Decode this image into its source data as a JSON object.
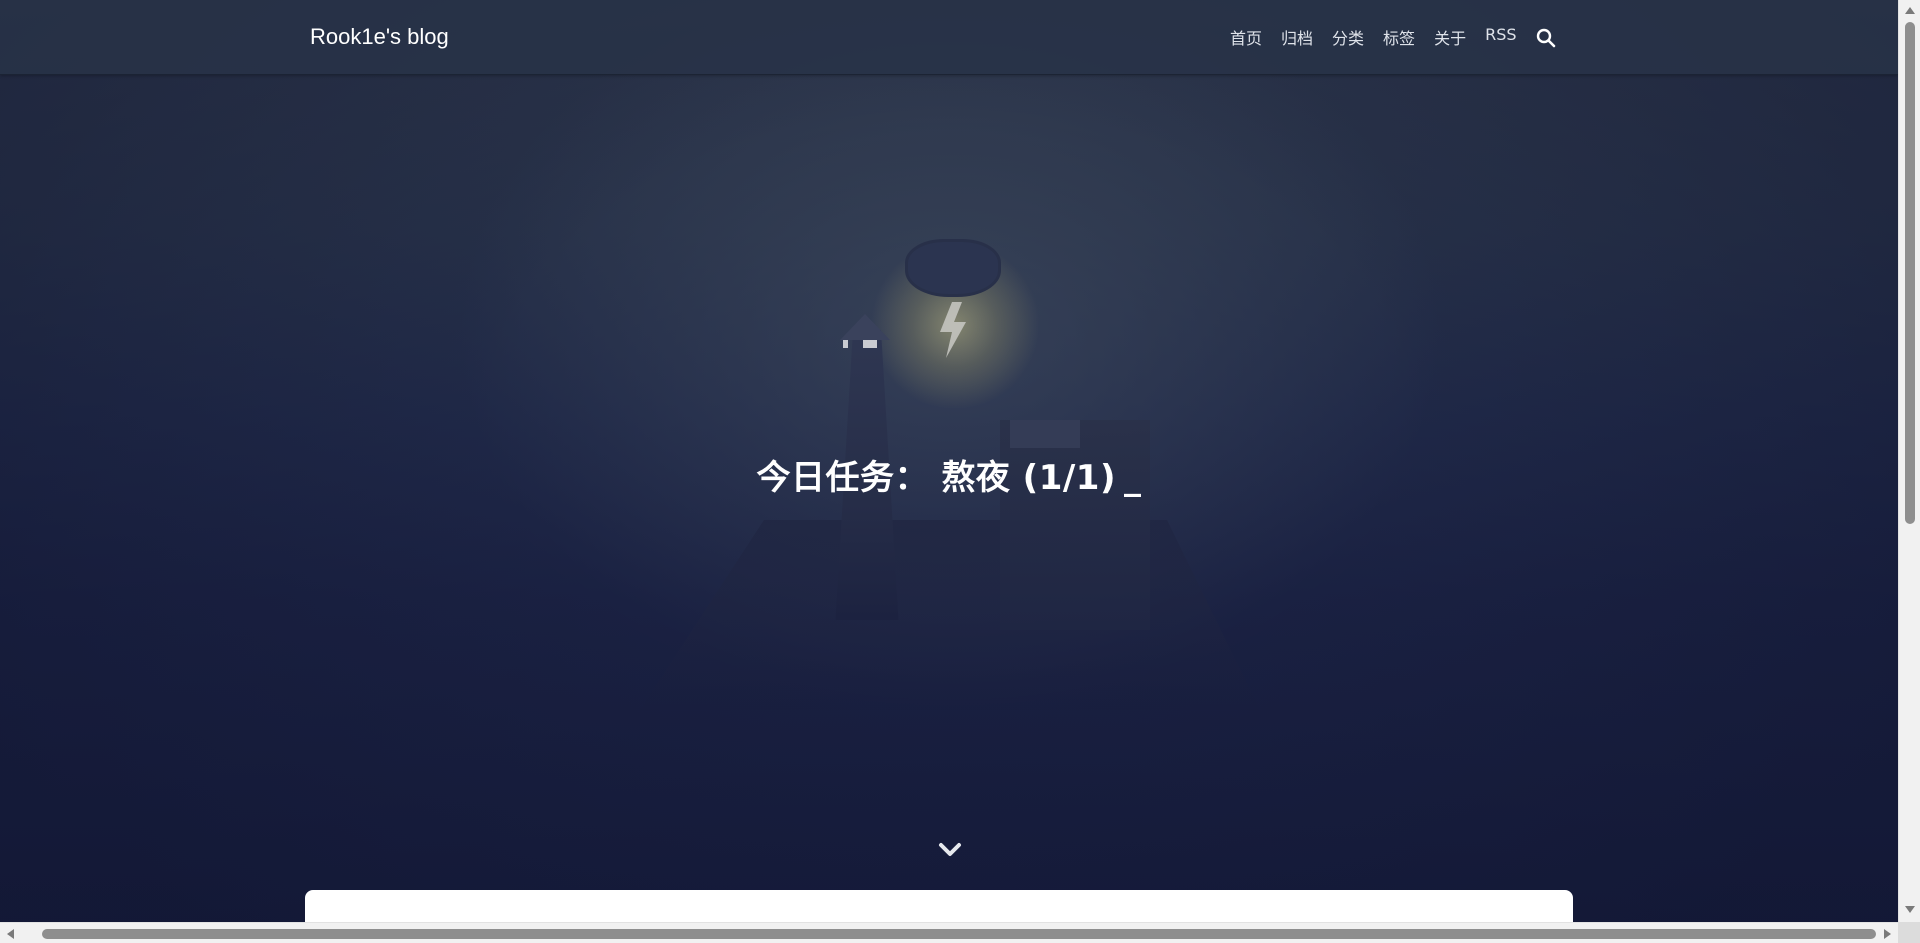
{
  "navbar": {
    "brand": "Rook1e's blog",
    "menu": [
      {
        "label": "首页"
      },
      {
        "label": "归档"
      },
      {
        "label": "分类"
      },
      {
        "label": "标签"
      },
      {
        "label": "关于"
      },
      {
        "label": "RSS"
      }
    ],
    "search_icon": "search-icon"
  },
  "banner": {
    "text": "今日任务： 熬夜 (1/1)",
    "cursor": "_"
  },
  "scroll_down_icon": "chevron-down-icon",
  "colors": {
    "navbar_bg": "#283248",
    "hero_bg": "#1a2142",
    "text": "#ffffff",
    "card_bg": "#ffffff"
  }
}
